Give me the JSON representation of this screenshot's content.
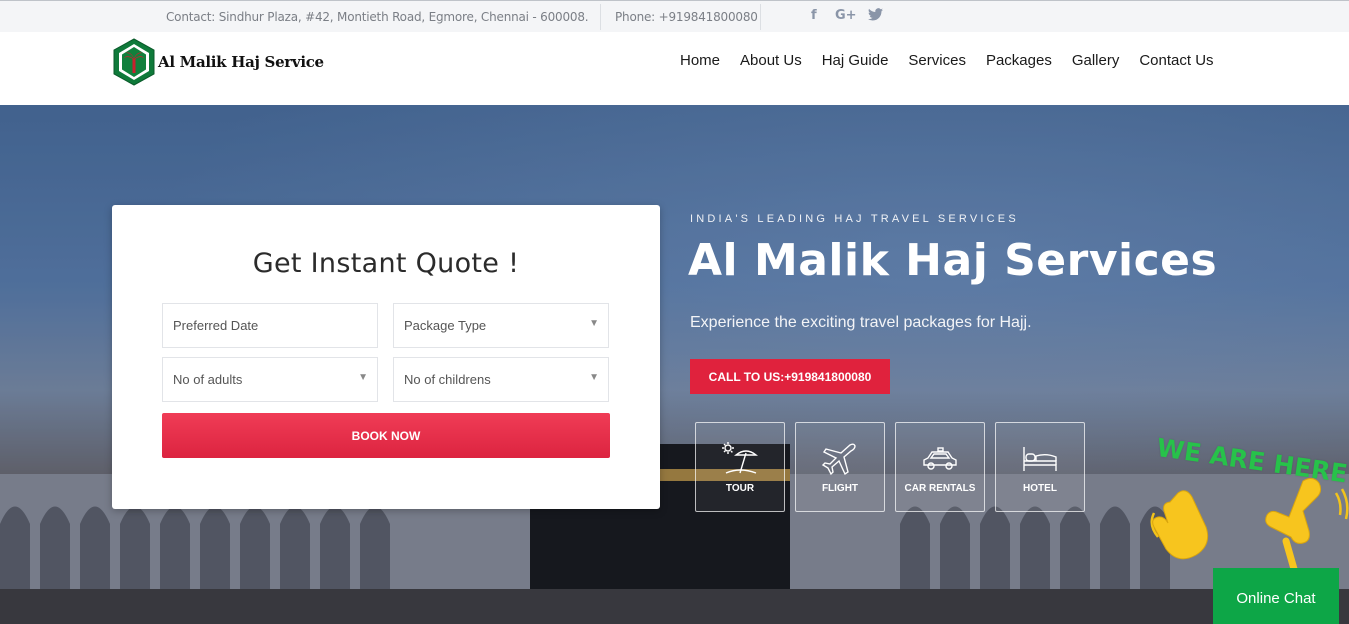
{
  "topbar": {
    "contact": "Contact: Sindhur Plaza, #42, Montieth Road, Egmore, Chennai - 600008.",
    "phone": "Phone: +919841800080",
    "social": [
      "f",
      "G+",
      "t"
    ],
    "social_icons": [
      "facebook-icon",
      "google-plus-icon",
      "twitter-icon"
    ]
  },
  "header": {
    "logo_text": "Al Malik Haj Service",
    "nav": [
      "Home",
      "About Us",
      "Haj Guide",
      "Services",
      "Packages",
      "Gallery",
      "Contact Us"
    ]
  },
  "quote": {
    "title": "Get Instant Quote !",
    "date_placeholder": "Preferred Date",
    "package_type": "Package Type",
    "adults": "No of adults",
    "children": "No of childrens",
    "book_label": "BOOK NOW"
  },
  "hero": {
    "eyebrow": "INDIA'S LEADING HAJ TRAVEL SERVICES",
    "title": "Al Malik Haj Services",
    "subtitle": "Experience the exciting travel packages for Hajj.",
    "call_label": "CALL TO US:+919841800080",
    "services": [
      {
        "label": "TOUR",
        "icon": "beach-umbrella-icon"
      },
      {
        "label": "FLIGHT",
        "icon": "airplane-icon"
      },
      {
        "label": "CAR RENTALS",
        "icon": "car-icon"
      },
      {
        "label": "HOTEL",
        "icon": "bed-icon"
      }
    ]
  },
  "chat": {
    "we_are_here": "WE ARE HERE!",
    "online_chat": "Online Chat"
  },
  "colors": {
    "accent_red": "#e0223d",
    "chat_green": "#0da647",
    "logo_green": "#0f7a3a"
  }
}
